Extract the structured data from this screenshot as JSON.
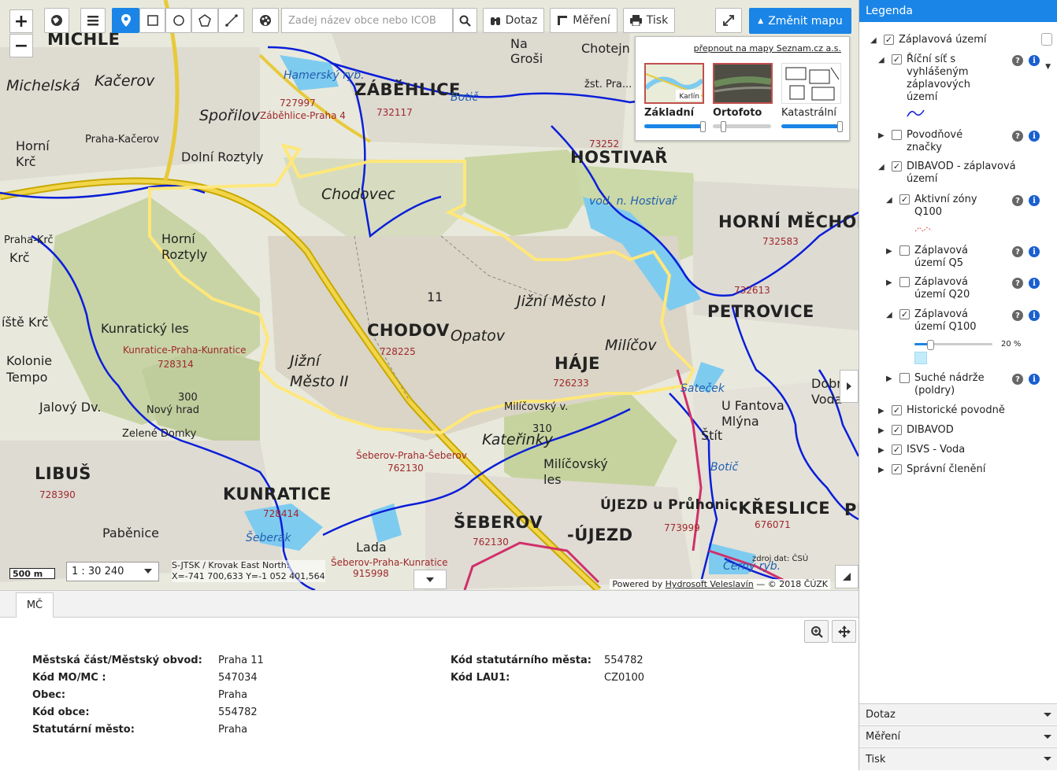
{
  "toolbar": {
    "zoom_in": "+",
    "zoom_out": "−",
    "search_placeholder": "Zadej název obce nebo ICOB",
    "query_label": "Dotaz",
    "measure_label": "Měření",
    "print_label": "Tisk",
    "change_map_label": "Změnit mapu",
    "icons": [
      "globe-icon",
      "menu-icon",
      "marker-icon",
      "rectangle-icon",
      "circle-icon",
      "polygon-icon",
      "line-icon",
      "palette-icon",
      "search-icon",
      "binoculars-icon",
      "ruler-icon",
      "printer-icon",
      "fullscreen-icon"
    ]
  },
  "basemap_switcher": {
    "link": "přepnout na mapy Seznam.cz a.s.",
    "options": [
      {
        "label": "Základní",
        "opacity": 1.0
      },
      {
        "label": "Ortofoto",
        "opacity": 0.0
      },
      {
        "label": "Katastrální",
        "opacity": 1.0
      }
    ],
    "thumb_label": "Karlín"
  },
  "map": {
    "labels": {
      "michle_top": "MICHLE",
      "michelska": "Michelská",
      "kacerov": "Kačerov",
      "sporilov": "Spořilov",
      "horni_krc": "Horní Krč",
      "praha_kacerov": "Praha-Kačerov",
      "dolni_roztyly": "Dolní Roztyly",
      "zabehlice": "ZÁBĚHLICE",
      "hamersky": "Hamerský ryb.",
      "botic": "Botič",
      "na_grosi": "Na Groši",
      "chotejn": "Chotejn",
      "zst_pra": "žst. Pra...",
      "hostivar": "HOSTIVAŘ",
      "vod_hostivar": "vod. n. Hostivař",
      "horni_mecholupy": "HORNÍ MĚCHOLUPY",
      "chodovec": "Chodovec",
      "horni_roztyly": "Horní Roztyly",
      "praha_krc": "Praha-Krč",
      "krc": "Krč",
      "jiste_krc": "íště Krč",
      "kunraticky_les": "Kunratický les",
      "kunratice_praha": "Kunratice-Praha-Kunratice",
      "kolonie_tempo": "Kolonie Tempo",
      "jalovy_dv": "Jalový Dv.",
      "novy_hrad": "Nový hrad",
      "zelene_domky": "Zelené Domky",
      "libus": "LIBUŠ",
      "kunratice": "KUNRATICE",
      "pabenice": "Paběnice",
      "seberak": "Šeberák",
      "lada": "Lada",
      "sebe_kunratice": "Šeberov-Praha-Kunratice",
      "sebe_sebe": "Šeberov-Praha-Šeberov",
      "seberov": "ŠEBEROV",
      "ujezd": "-ÚJEZD",
      "ujezd_pruhonic": "ÚJEZD u Průhonic",
      "milicovsky_les": "Milíčovský les",
      "milicovsky_v": "Milíčovský v.",
      "milicov": "Milíčov",
      "katerinky": "Kateřinky",
      "jizni_mesto_i": "Jižní Město I",
      "jizni_mesto_ii": "Jižní Město II",
      "chodov": "CHODOV",
      "opatov": "Opatov",
      "haje": "HÁJE",
      "num_11": "11",
      "petrovice": "PETROVICE",
      "satecek": "Sateček",
      "u_fantova": "U Fantova Mlýna",
      "stit": "Štít",
      "dobra_voda": "Dobrá Voda",
      "kreslice": "-KŘESLICE",
      "cerny_ryb": "Černý ryb.",
      "botic2": "Botič",
      "p_edge": "PI",
      "h300": "300",
      "h310": "310",
      "zabehlice_praha4": "Záběhlice-Praha 4"
    },
    "codes": {
      "c727997": "727997",
      "c732117": "732117",
      "c732583": "732583",
      "c732613": "732613",
      "c728314": "728314",
      "c728225": "728225",
      "c726233": "726233",
      "c762130a": "762130",
      "c762130b": "762130",
      "c728390": "728390",
      "c728414": "728414",
      "c915998": "915998",
      "c773999": "773999",
      "c676071": "676071",
      "c73252": "73252"
    },
    "scale_bar": "500 m",
    "scale": "1 : 30 240",
    "coords_line1": "S-JTSK / Krovak East North:",
    "coords_line2": "X=-741 700,633 Y=-1 052 401,564",
    "powered_by": "Powered by",
    "powered_link": "Hydrosoft Veleslavín",
    "copyright": "— © 2018 ČÚZK",
    "source": "zdroj dat: ČSÚ"
  },
  "bottom_panel": {
    "tab": "MČ",
    "left_rows": [
      {
        "key": "Městská část/Městský obvod:",
        "value": "Praha 11"
      },
      {
        "key": "Kód MO/MC :",
        "value": "547034"
      },
      {
        "key": "Obec:",
        "value": "Praha"
      },
      {
        "key": "Kód obce:",
        "value": "554782"
      },
      {
        "key": "Statutární město:",
        "value": "Praha"
      }
    ],
    "right_rows": [
      {
        "key": "Kód statutárního města:",
        "value": "554782"
      },
      {
        "key": "Kód LAU1:",
        "value": "CZ0100"
      }
    ]
  },
  "legend": {
    "title": "Legenda",
    "items": [
      {
        "label": "Záplavová území",
        "checked": true
      },
      {
        "label": "Říční síť s vyhlášeným záplavových území",
        "checked": true
      },
      {
        "label": "Povodňové značky",
        "checked": false
      },
      {
        "label": "DIBAVOD - záplavová území",
        "checked": true
      },
      {
        "label": "Aktivní zóny Q100",
        "checked": true
      },
      {
        "label": "Záplavová území Q5",
        "checked": false
      },
      {
        "label": "Záplavová území Q20",
        "checked": false
      },
      {
        "label": "Záplavová území Q100",
        "checked": true
      },
      {
        "label": "Suché nádrže (poldry)",
        "checked": false
      },
      {
        "label": "Historické povodně",
        "checked": true
      },
      {
        "label": "DIBAVOD",
        "checked": true
      },
      {
        "label": "ISVS - Voda",
        "checked": true
      },
      {
        "label": "Správní členění",
        "checked": true
      }
    ],
    "q100_opacity": "20 %",
    "q100_opacity_value": 0.2
  },
  "accordions": [
    "Dotaz",
    "Měření",
    "Tisk"
  ],
  "colors": {
    "accent": "#1a85e6",
    "river": "#0a1ed8",
    "boundary": "#ffe77a",
    "district": "#d0306a"
  }
}
